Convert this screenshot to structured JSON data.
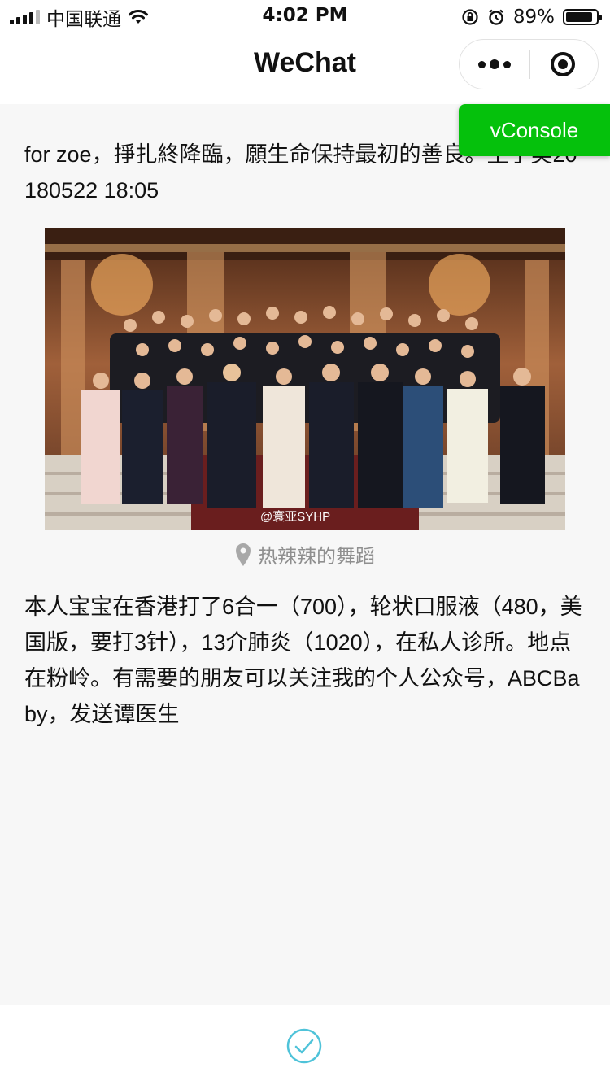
{
  "status_bar": {
    "carrier": "中国联通",
    "time": "4:02 PM",
    "battery": "89%",
    "battery_level": 0.89
  },
  "nav": {
    "title": "WeChat"
  },
  "post": {
    "intro_line": " for zoe，掙扎終降臨，願生命保持最初的善良。生于美20180522 18:05",
    "photo_watermark": "@寰亚SYHP",
    "location": "热辣辣的舞蹈",
    "body": " 本人宝宝在香港打了6合一（700），轮状口服液（480，美国版，要打3针），13介肺炎（1020），在私人诊所。地点在粉岭。有需要的朋友可以关注我的个人公众号，ABCBaby，发送谭医生"
  },
  "vconsole": {
    "label": "vConsole",
    "color": "#05c10c"
  },
  "footer": {
    "icon": "check-circle-icon",
    "accent": "#4fc3d9"
  },
  "icons": {
    "signal": "signal-bars-icon",
    "wifi": "wifi-icon",
    "lock": "orientation-lock-icon",
    "alarm": "alarm-clock-icon",
    "more": "more-dots-icon",
    "close": "close-miniprogram-icon",
    "location": "location-pin-icon"
  }
}
